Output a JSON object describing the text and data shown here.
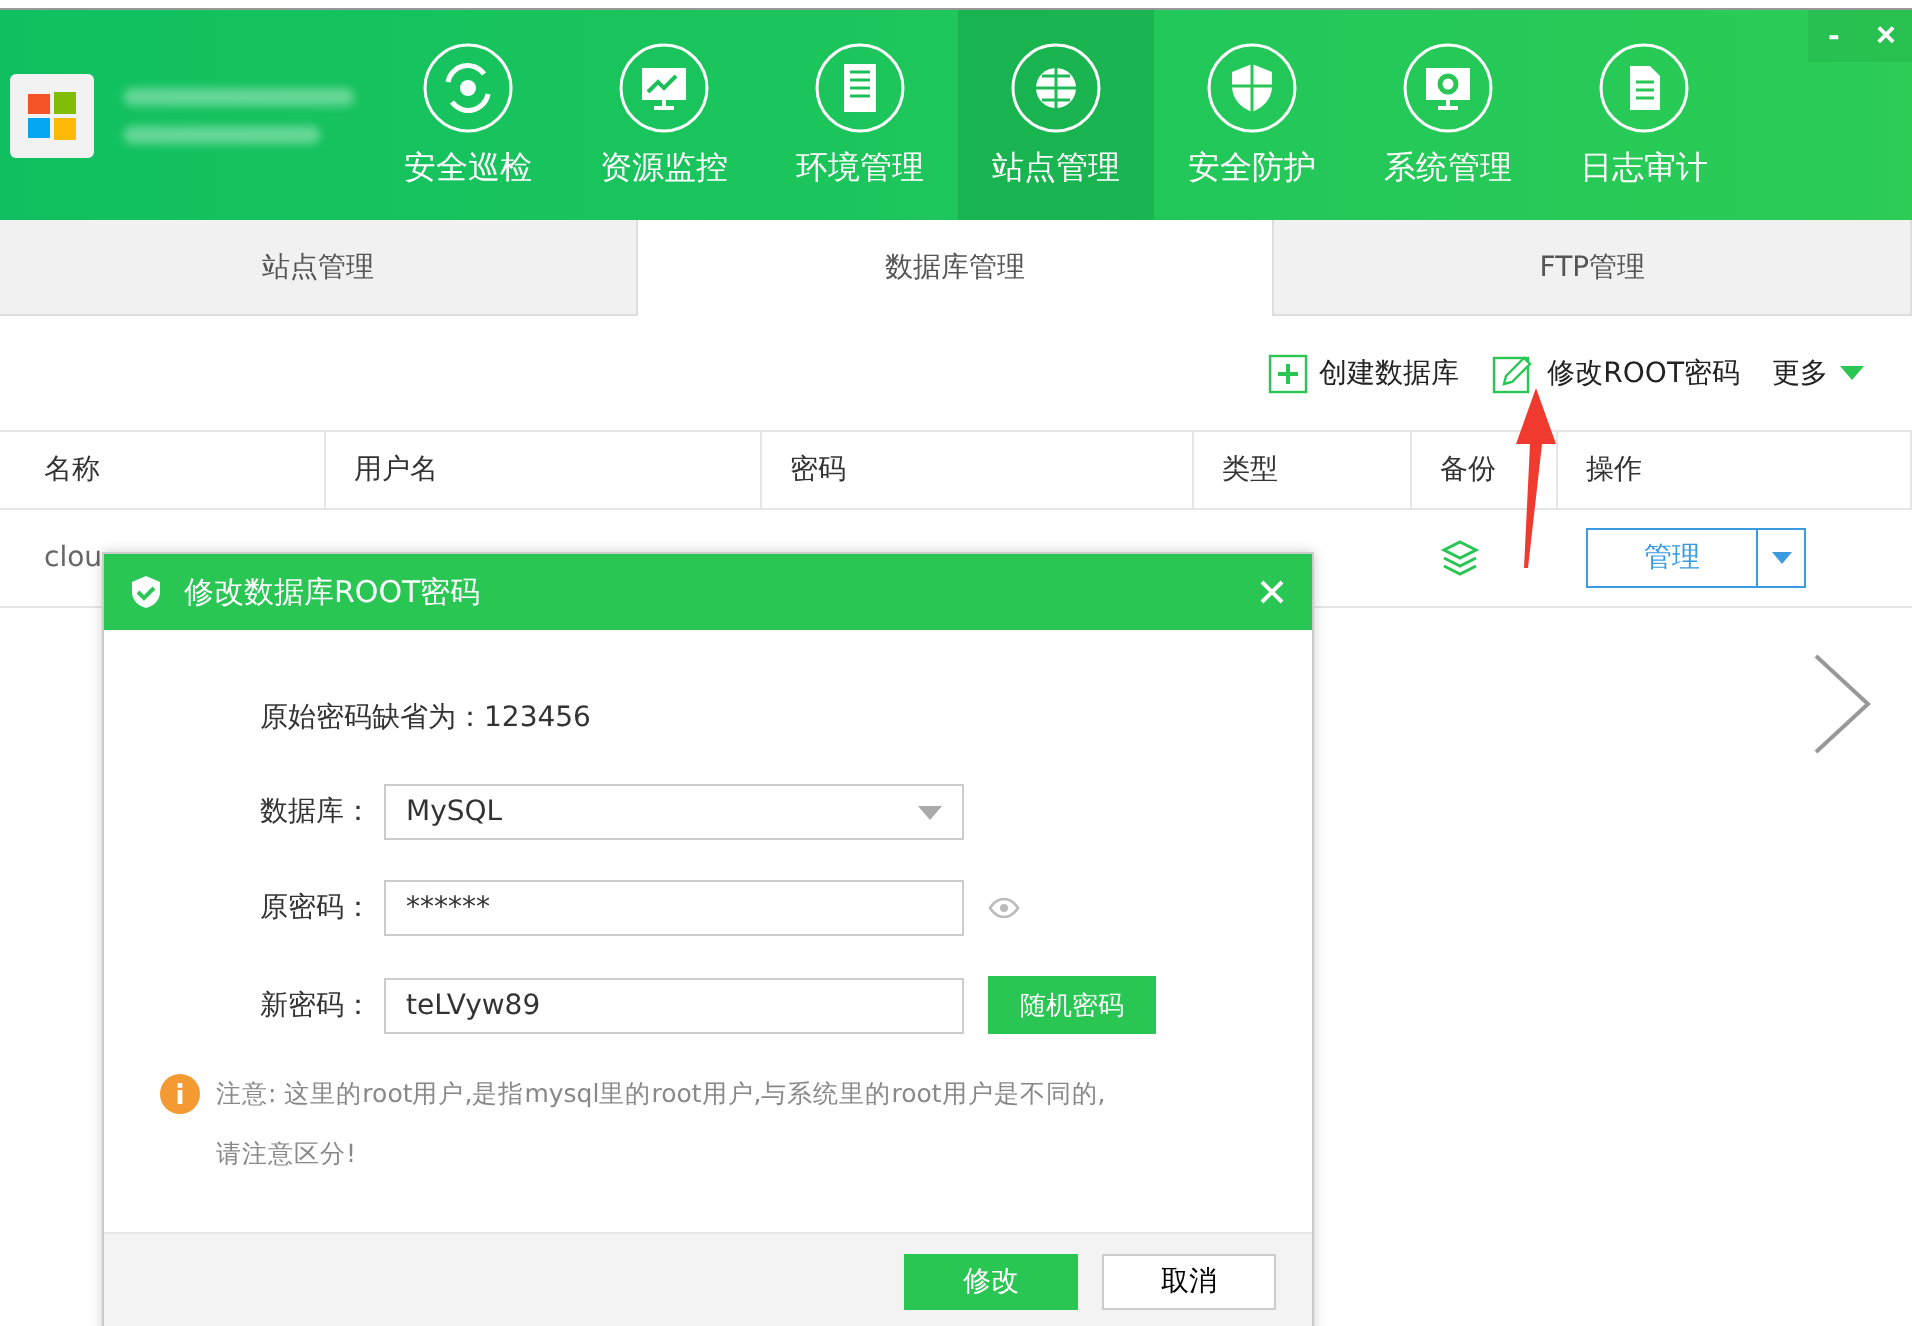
{
  "nav": [
    {
      "label": "安全巡检",
      "selected": false
    },
    {
      "label": "资源监控",
      "selected": false
    },
    {
      "label": "环境管理",
      "selected": false
    },
    {
      "label": "站点管理",
      "selected": true
    },
    {
      "label": "安全防护",
      "selected": false
    },
    {
      "label": "系统管理",
      "selected": false
    },
    {
      "label": "日志审计",
      "selected": false
    }
  ],
  "window_controls": [
    "-",
    "×"
  ],
  "tabs": [
    {
      "label": "站点管理",
      "selected": false
    },
    {
      "label": "数据库管理",
      "selected": true
    },
    {
      "label": "FTP管理",
      "selected": false
    }
  ],
  "toolbar": {
    "create": "创建数据库",
    "change_root": "修改ROOT密码",
    "more": "更多"
  },
  "table": {
    "columns": [
      "名称",
      "用户名",
      "密码",
      "类型",
      "备份",
      "操作"
    ],
    "rows": [
      {
        "name": "clou",
        "action": "管理"
      }
    ]
  },
  "dialog": {
    "title": "修改数据库ROOT密码",
    "default_note": "原始密码缺省为：123456",
    "fields": [
      {
        "kind": "select",
        "label": "数据库：",
        "value": "MySQL"
      },
      {
        "kind": "password",
        "label": "原密码：",
        "value": "******"
      },
      {
        "kind": "text",
        "label": "新密码：",
        "value": "teLVyw89",
        "button": "随机密码"
      }
    ],
    "warning": "注意: 这里的root用户,是指mysql里的root用户,与系统里的root用户是不同的,\n请注意区分!",
    "buttons": [
      {
        "label": "修改",
        "primary": true
      },
      {
        "label": "取消",
        "primary": false
      }
    ]
  }
}
